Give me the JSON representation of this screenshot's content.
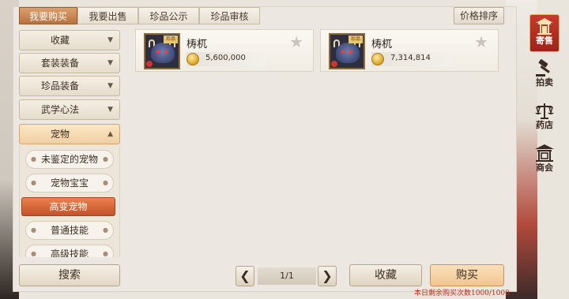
{
  "tabs": [
    {
      "label": "我要购买"
    },
    {
      "label": "我要出售"
    },
    {
      "label": "珍品公示"
    },
    {
      "label": "珍品审核"
    }
  ],
  "sort_button": "价格排序",
  "categories": [
    {
      "label": "收藏",
      "arrow": "▼"
    },
    {
      "label": "套装装备",
      "arrow": "▼"
    },
    {
      "label": "珍品装备",
      "arrow": "▼"
    },
    {
      "label": "武学心法",
      "arrow": "▼"
    },
    {
      "label": "宠物",
      "arrow": "▲"
    }
  ],
  "subcategories": [
    {
      "label": "未鉴定的宠物"
    },
    {
      "label": "宠物宝宝"
    },
    {
      "label": "高变宠物"
    },
    {
      "label": "普通技能"
    },
    {
      "label": "高级技能"
    }
  ],
  "items": [
    {
      "name": "梼杌",
      "price": "5,600,000",
      "tag": "珍品",
      "icon": "bull-beast-icon"
    },
    {
      "name": "梼杌",
      "price": "7,314,814",
      "tag": "珍品",
      "icon": "bull-beast-icon"
    }
  ],
  "bottom": {
    "search": "搜索",
    "prev": "❮",
    "page": "1/1",
    "next": "❯",
    "favorite": "收藏",
    "buy": "购买",
    "remaining": "本日剩余购买次数1000/1000"
  },
  "right_nav": [
    {
      "label": "寄售",
      "icon": "pavilion-icon"
    },
    {
      "label": "拍卖",
      "icon": "gavel-icon"
    },
    {
      "label": "药店",
      "icon": "scale-icon"
    },
    {
      "label": "商会",
      "icon": "guild-hall-icon"
    }
  ],
  "colors": {
    "accent": "#c4512a",
    "tab_active": "#b8723f",
    "nav_active": "#c8392c",
    "warning_text": "#c02a1a"
  }
}
